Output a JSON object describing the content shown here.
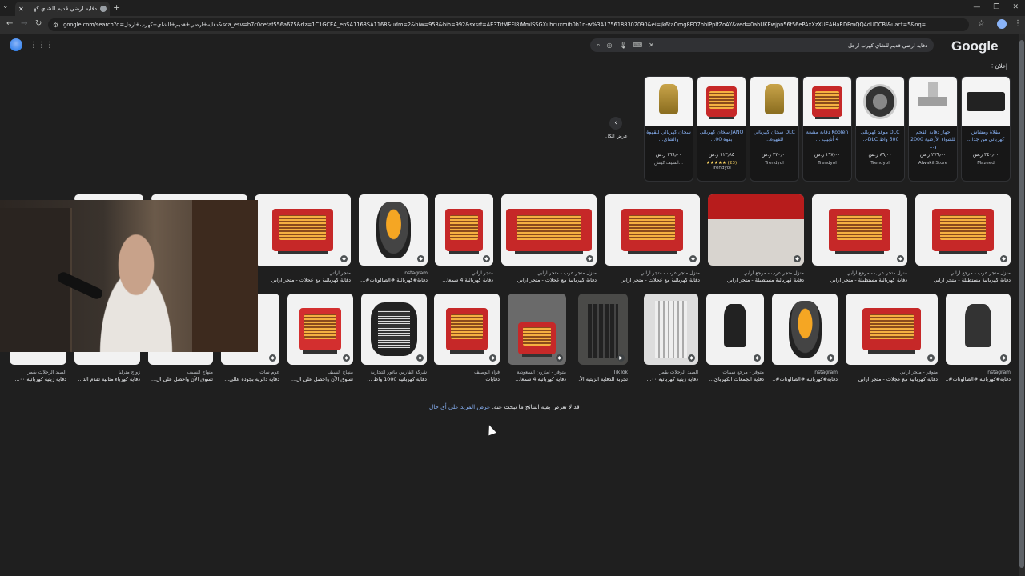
{
  "browser": {
    "tab_title": "دفايه ارضي قديم للشاي كهرب ارجل",
    "tab_close": "✕",
    "new_tab": "+",
    "window_controls": [
      "—",
      "❐",
      "✕"
    ],
    "url": "google.com/search?q=دفايه+ارضي+قديم+للشاي+كهرب+ارجل&sca_esv=b7c0cefaf556a675&rlz=1C1GCEA_enSA1168SA1168&udm=2&biw=958&bih=992&sxsrf=AE3TifMEFI8iMmlSSGXuhcuxmib0h1n-w%3A1756188302090&ei=jk6taOmg8FO7hbIPpIfZoAY&ved=0ahUKEwjpn56f56ePAxXzXUEAHaRDFmQQ4dUDCBI&uact=5&oq=..."
  },
  "google": {
    "logo": "Google",
    "query": "دفايه ارضي قديم للشاي كهرب ارجل",
    "ad_label": "إعلان"
  },
  "shopping": {
    "see_all": "عرض الكل",
    "products": [
      {
        "title": "مقلاة ومشاش كهربائي من جدا...",
        "price": "٣٤٠٫٠٠ ر.س",
        "store": "Mazeed",
        "rating": ""
      },
      {
        "title": "جهاز دفاية الفحم للشواء الأرضية 2000 و...",
        "price": "٢٧٩٫٠٠ ر.س",
        "store": "Alwakil Store",
        "rating": ""
      },
      {
        "title": "DLC موقد كهربائي 500 واط DLC-...",
        "price": "٨٩٫٠٠ ر.س",
        "store": "Trendyol",
        "rating": ""
      },
      {
        "title": "Koolen دفاية مشعة 4 أنابيب ...",
        "price": "١٩٧٫٠٠ ر.س",
        "store": "Trendyol",
        "rating": ""
      },
      {
        "title": "DLC سخان كهربائي للقهوة...",
        "price": "٢٢٠٫٠٠ ر.س",
        "store": "Trendyol",
        "rating": ""
      },
      {
        "title": "JANO سخان كهربائي بقوة 00...",
        "price": "١١٣٫٨٥ ر.س",
        "store": "Trendyol",
        "rating": "★★★★★ (23)"
      },
      {
        "title": "سخان كهربائي للقهوة والشاي...",
        "price": "١٦٩٫٠٠ ر.س",
        "store": "السيف كيتش...",
        "rating": ""
      }
    ]
  },
  "images_row1": [
    {
      "source": "منزل متجر عرب - مرجع ارابي",
      "title": "دفاية كهربائية مستطيلة - متجر ارابي"
    },
    {
      "source": "منزل متجر عرب - مرجع ارابي",
      "title": "دفاية كهربائية مستطيلة - متجر ارابي"
    },
    {
      "source": "منزل متجر عرب - مرجع ارابي",
      "title": "دفاية كهربائية مستطيلة - متجر ارابي"
    },
    {
      "source": "منزل متجر عرب - متجر ارابي",
      "title": "دفاية كهربائية مع عجلات - متجر ارابي"
    },
    {
      "source": "منزل متجر عرب - متجر ارابي",
      "title": "دفاية كهربائية مع عجلات - متجر ارابي"
    },
    {
      "source": "متجر اراتي",
      "title": "دفاية كهربائية 4 شمعا..."
    },
    {
      "source": "Instagram",
      "title": "دفاية#كهربائية #الصالونات#..."
    },
    {
      "source": "متجر اراتي",
      "title": "دفاية كهربائية مع عجلات - متجر ارابي"
    }
  ],
  "images_row2": [
    {
      "source": "Instagram",
      "title": "دفاية#كهربائية #الصالونات#..."
    },
    {
      "source": "متوفر - متجر ارابي",
      "title": "دفاية كهربائية مع عجلات - متجر ارابي"
    },
    {
      "source": "Instagram",
      "title": "دفاية#كهربائية #الصالونات#..."
    },
    {
      "source": "متوفر - مرجع سمات",
      "title": "دفاية الجمعات الكهربائ..."
    },
    {
      "source": "الصيد الرحلات بقمر",
      "title": "دفاية زيتية كهربائية ٠٠..."
    },
    {
      "source": "TikTok",
      "title": "تجربة الدفاية الزيتية الأ..."
    },
    {
      "source": "متوفر - أمازون السعودية",
      "title": "دفاية كهربائية 4 شمعا..."
    },
    {
      "source": "فؤاد الوصيف",
      "title": "دفايات"
    },
    {
      "source": "شركة الفارس ماتور التجارية",
      "title": "دفاية كهربائية 1000 واط ..."
    },
    {
      "source": "منهاج السيف",
      "title": "تسوق الآن واحصل على ال..."
    },
    {
      "source": "عوم سات",
      "title": "دفاية دائرية بجودة عالي..."
    },
    {
      "source": "منهاج السيف",
      "title": "تسوق الآن واحصل على ال..."
    },
    {
      "source": "زواج مترليا",
      "title": "دفاية كهرباء مثالية تقدم الد..."
    },
    {
      "source": "الصيد الرحلات بقمر",
      "title": "دفاية زيتية كهربائية ٠٠..."
    }
  ],
  "footer": {
    "notice": "قد لا تعرض بقية النتائج ما تبحث عنه.",
    "link": "عرض المزيد على أي حال"
  }
}
